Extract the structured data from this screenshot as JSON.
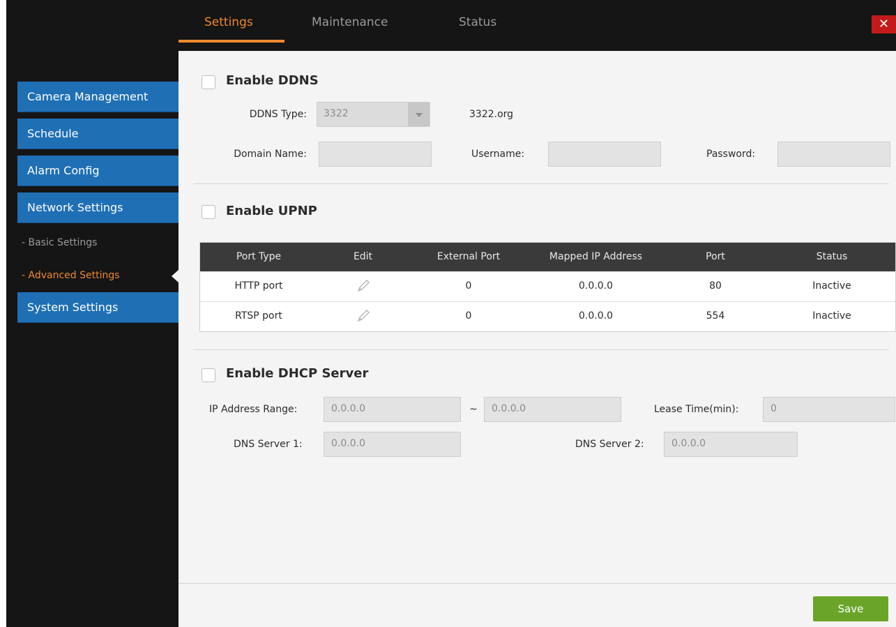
{
  "tabs": [
    {
      "label": "Settings",
      "active": true
    },
    {
      "label": "Maintenance",
      "active": false
    },
    {
      "label": "Status",
      "active": false
    }
  ],
  "close_label": "✕",
  "sidebar": {
    "items": [
      {
        "label": "Camera Management"
      },
      {
        "label": "Schedule"
      },
      {
        "label": "Alarm Config"
      },
      {
        "label": "Network Settings"
      }
    ],
    "subitems": [
      {
        "label": "- Basic Settings",
        "active": false
      },
      {
        "label": "- Advanced Settings",
        "active": true
      }
    ],
    "last_item": {
      "label": "System Settings"
    }
  },
  "ddns": {
    "enable_label": "Enable DDNS",
    "enabled": false,
    "type_label": "DDNS Type:",
    "type_value": "3322",
    "provider": "3322.org",
    "domain_label": "Domain Name:",
    "domain_value": "",
    "username_label": "Username:",
    "username_value": "",
    "password_label": "Password:",
    "password_value": ""
  },
  "upnp": {
    "enable_label": "Enable UPNP",
    "enabled": false,
    "columns": [
      "Port Type",
      "Edit",
      "External Port",
      "Mapped IP Address",
      "Port",
      "Status"
    ],
    "rows": [
      {
        "port_type": "HTTP port",
        "external_port": "0",
        "mapped_ip": "0.0.0.0",
        "port": "80",
        "status": "Inactive"
      },
      {
        "port_type": "RTSP port",
        "external_port": "0",
        "mapped_ip": "0.0.0.0",
        "port": "554",
        "status": "Inactive"
      }
    ]
  },
  "dhcp": {
    "enable_label": "Enable DHCP Server",
    "enabled": false,
    "range_label": "IP Address Range:",
    "range_start": "0.0.0.0",
    "range_sep": "~",
    "range_end": "0.0.0.0",
    "lease_label": "Lease Time(min):",
    "lease_value": "0",
    "dns1_label": "DNS Server 1:",
    "dns1_value": "0.0.0.0",
    "dns2_label": "DNS Server 2:",
    "dns2_value": "0.0.0.0"
  },
  "save_label": "Save",
  "colors": {
    "accent": "#f0892e",
    "sidebar_blue": "#1f6fb5",
    "save_green": "#6aa52a",
    "close_red": "#c31b1b"
  },
  "icons": {
    "edit": "pencil-icon",
    "close": "close-icon",
    "dropdown": "chevron-down-icon"
  }
}
